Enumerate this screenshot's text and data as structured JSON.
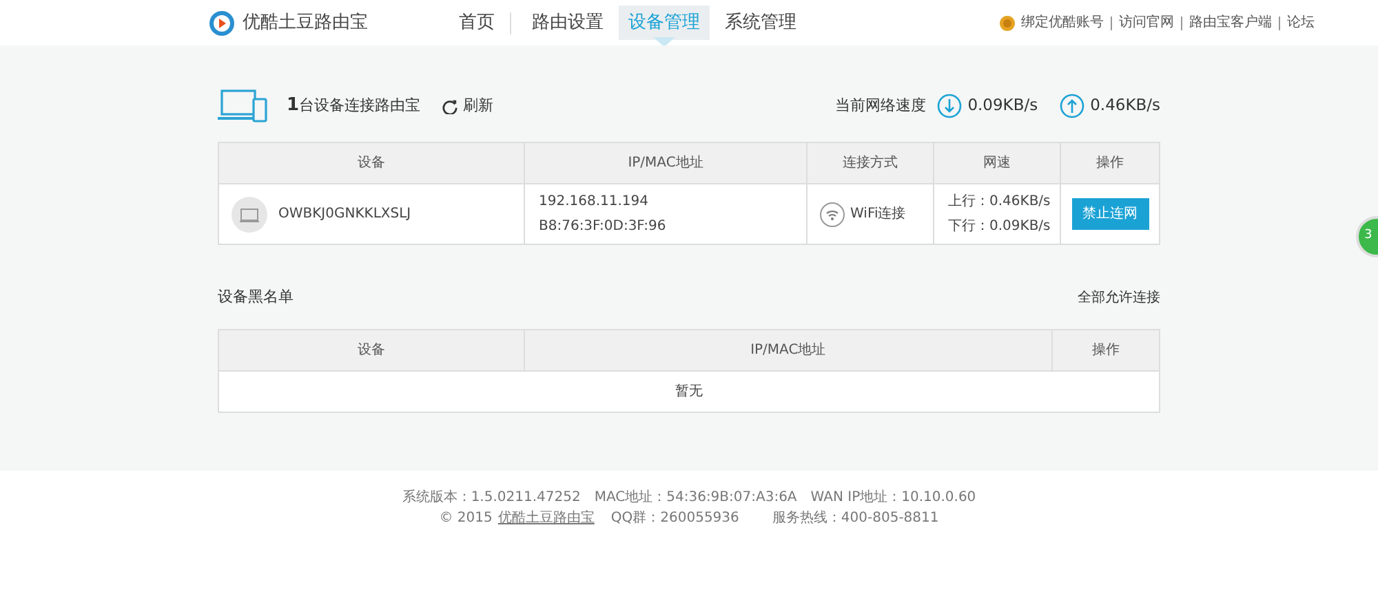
{
  "brand": "优酷土豆路由宝",
  "nav": [
    {
      "label": "首页",
      "selected": false
    },
    {
      "label": "路由设置",
      "selected": false
    },
    {
      "label": "设备管理",
      "selected": true
    },
    {
      "label": "系统管理",
      "selected": false
    }
  ],
  "top_links": [
    "绑定优酷账号",
    "访问官网",
    "路由宝客户端",
    "论坛"
  ],
  "summary": {
    "count": "1",
    "text": "台设备连接路由宝",
    "refresh": "刷新",
    "speed_label": "当前网络速度",
    "down": "0.09KB/s",
    "up": "0.46KB/s"
  },
  "devices": {
    "columns": [
      "设备",
      "IP/MAC地址",
      "连接方式",
      "网速",
      "操作"
    ],
    "rows": [
      {
        "name": "OWBKJ0GNKKLXSLJ",
        "ip": "192.168.11.194",
        "mac": "B8:76:3F:0D:3F:96",
        "connection": "WiFi连接",
        "upload": "上行：0.46KB/s",
        "download": "下行：0.09KB/s",
        "action": "禁止连网"
      }
    ]
  },
  "blacklist": {
    "title": "设备黑名单",
    "allow_all": "全部允许连接",
    "columns": [
      "设备",
      "IP/MAC地址",
      "操作"
    ],
    "empty": "暂无"
  },
  "footer": {
    "line1": [
      "系统版本：1.5.0211.47252",
      "MAC地址：54:36:9B:07:A3:6A",
      "WAN IP地址：10.10.0.60"
    ],
    "copyright": "© 2015",
    "brand_link": "优酷土豆路由宝",
    "line2": [
      "QQ群：260055936",
      "服务热线：400-805-8811"
    ]
  },
  "floating_badge": "3"
}
